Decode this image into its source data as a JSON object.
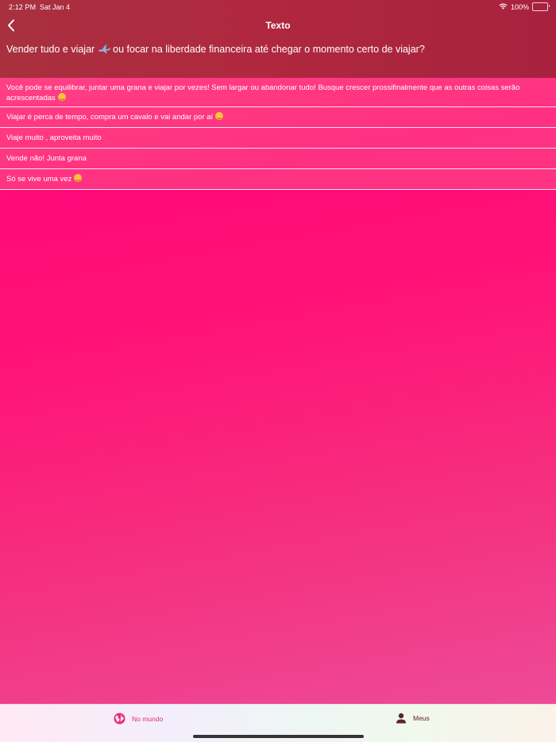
{
  "status_bar": {
    "time": "2:12 PM",
    "date": "Sat Jan 4",
    "battery_percent": "100%",
    "icons": [
      "wifi-icon",
      "battery-icon"
    ]
  },
  "nav": {
    "title": "Texto",
    "back_icon": "chevron-left-icon"
  },
  "question": {
    "text_before": "Vender tudo e viajar",
    "icon": "airplane-icon",
    "text_after": "ou focar na liberdade financeira até chegar o momento certo de viajar?"
  },
  "answers": [
    {
      "text": "Você pode se equilibrar, juntar uma grana e viajar por vezes! Sem largar ou abandonar tudo! Busque crescer prossifinalmente que as outras coisas serão acrescentadas",
      "emoji": "smiling-face-emoji"
    },
    {
      "text": "Viajar é perca de tempo, compra um cavalo e vai andar por aí",
      "emoji": "laughing-face-emoji"
    },
    {
      "text": "Viaje muito , aproveita muito",
      "emoji": ""
    },
    {
      "text": "Vende não! Junta grana",
      "emoji": ""
    },
    {
      "text": "Só se vive uma vez",
      "emoji": "relieved-face-emoji"
    }
  ],
  "tabs": [
    {
      "label": "No mundo",
      "icon": "globe-icon",
      "active": true
    },
    {
      "label": "Meus",
      "icon": "person-icon",
      "active": false
    }
  ],
  "colors": {
    "header": "#ab2a3f",
    "background": "#ff0a78",
    "tab_active": "#e42c7a",
    "tab_inactive": "#5a2436"
  }
}
